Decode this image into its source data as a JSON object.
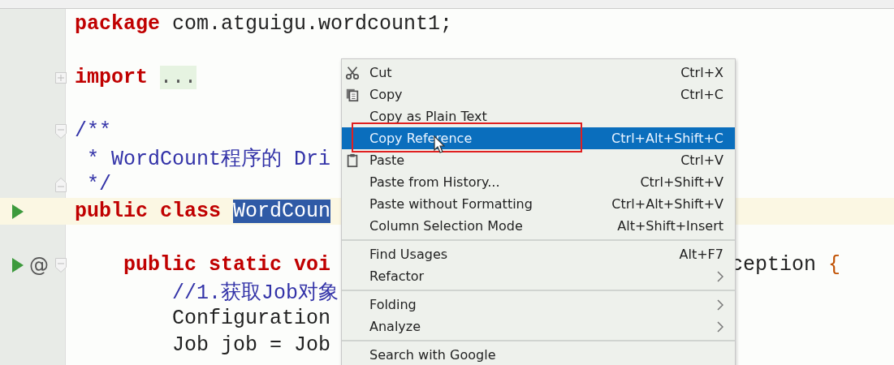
{
  "code_lines": [
    {
      "tokens": [
        {
          "text": "package",
          "kind": "keyword"
        },
        {
          "text": "com.atguigu.wordcount1;",
          "kind": "plain"
        }
      ]
    },
    {
      "kind": "blank"
    },
    {
      "tokens": [
        {
          "text": "import",
          "kind": "keyword"
        },
        {
          "text": "...",
          "kind": "folded"
        }
      ]
    },
    {
      "kind": "blank"
    },
    {
      "tokens": [
        {
          "text": "/**",
          "kind": "comment"
        }
      ]
    },
    {
      "tokens": [
        {
          "text": " * WordCount程序的 Dri",
          "kind": "comment"
        }
      ]
    },
    {
      "tokens": [
        {
          "text": " */",
          "kind": "comment"
        }
      ]
    },
    {
      "current": true,
      "tokens": [
        {
          "text": "public class",
          "kind": "keyword"
        },
        {
          "text": "WordCoun",
          "kind": "selected"
        }
      ]
    },
    {
      "kind": "blank"
    },
    {
      "gutter_text": "@",
      "tokens": [
        {
          "text": "    public static voi",
          "kind": "keyword"
        }
      ],
      "tail": [
        {
          "text": "ception",
          "kind": "plain"
        },
        {
          "text": "{",
          "kind": "brace"
        }
      ]
    },
    {
      "tokens": [
        {
          "text": "        //1.获取Job对象",
          "kind": "comment"
        }
      ]
    },
    {
      "tokens": [
        {
          "text": "        Configuration",
          "kind": "plain"
        }
      ]
    },
    {
      "tokens": [
        {
          "text": "        Job job = Job",
          "kind": "plain"
        }
      ]
    }
  ],
  "context_menu": {
    "groups": [
      [
        {
          "label": "Cut",
          "shortcut": "Ctrl+X",
          "selected": false
        },
        {
          "label": "Copy",
          "shortcut": "Ctrl+C",
          "selected": false
        },
        {
          "label": "Copy as Plain Text",
          "selected": false
        },
        {
          "label": "Copy Reference",
          "shortcut": "Ctrl+Alt+Shift+C",
          "selected": true
        },
        {
          "label": "Paste",
          "shortcut": "Ctrl+V",
          "selected": false
        },
        {
          "label": "Paste from History...",
          "shortcut": "Ctrl+Shift+V",
          "selected": false
        },
        {
          "label": "Paste without Formatting",
          "shortcut": "Ctrl+Alt+Shift+V",
          "selected": false
        },
        {
          "label": "Column Selection Mode",
          "shortcut": "Alt+Shift+Insert",
          "selected": false
        }
      ],
      [
        {
          "label": "Find Usages",
          "shortcut": "Alt+F7",
          "selected": false
        },
        {
          "label": "Refactor",
          "submenu": true,
          "selected": false
        }
      ],
      [
        {
          "label": "Folding",
          "submenu": true,
          "selected": false
        },
        {
          "label": "Analyze",
          "submenu": true,
          "selected": false
        }
      ],
      [
        {
          "label": "Search with Google",
          "selected": false
        }
      ]
    ]
  }
}
